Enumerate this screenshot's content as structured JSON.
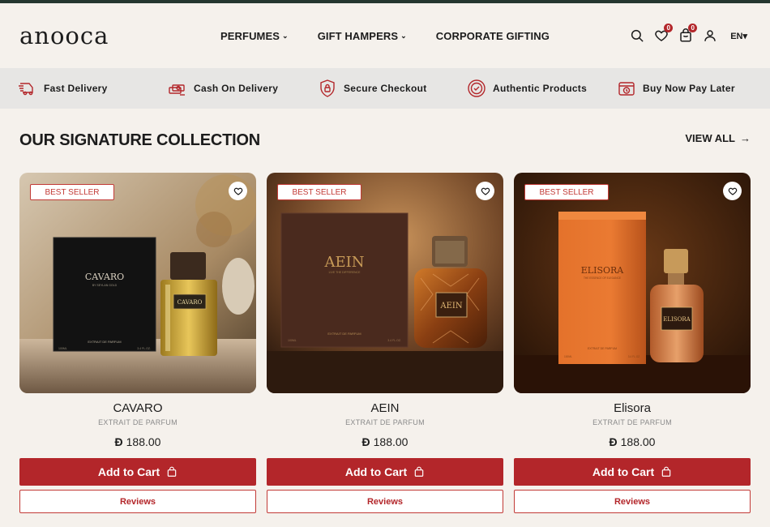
{
  "brand": {
    "logo": "anooca"
  },
  "nav": {
    "perfumes": "PERFUMES",
    "gift_hampers": "GIFT HAMPERS",
    "corporate_gifting": "CORPORATE GIFTING"
  },
  "header": {
    "wishlist_count": "0",
    "cart_count": "0",
    "language": "EN"
  },
  "features": [
    {
      "label": "Fast Delivery",
      "icon": "truck-icon"
    },
    {
      "label": "Cash On Delivery",
      "icon": "cash-icon"
    },
    {
      "label": "Secure Checkout",
      "icon": "shield-lock-icon"
    },
    {
      "label": "Authentic Products",
      "icon": "certified-badge-icon"
    },
    {
      "label": "Buy Now Pay Later",
      "icon": "clock-wallet-icon"
    }
  ],
  "section": {
    "title": "OUR SIGNATURE COLLECTION",
    "view_all": "VIEW ALL"
  },
  "products": [
    {
      "badge": "BEST SELLER",
      "name": "CAVARO",
      "type": "EXTRAIT DE PARFUM",
      "currency": "Đ",
      "price": "188.00",
      "add_to_cart": "Add to Cart",
      "reviews": "Reviews",
      "box_title": "CAVARO",
      "box_sub": "BY SEYLAN GOLD",
      "box_bottom": "EXTRAIT DE PARFUM",
      "box_vol_left": "100ML",
      "box_vol_right": "3.4 FL.OZ.",
      "bottle_label": "CAVARO"
    },
    {
      "badge": "BEST SELLER",
      "name": "AEIN",
      "type": "EXTRAIT DE PARFUM",
      "currency": "Đ",
      "price": "188.00",
      "add_to_cart": "Add to Cart",
      "reviews": "Reviews",
      "box_title": "AEIN",
      "box_sub": "LIVE THE DIFFERENCE",
      "box_bottom": "EXTRAIT DE PARFUM",
      "box_vol_left": "100ML",
      "box_vol_right": "3.4 FL.OZ.",
      "bottle_label": "AEIN"
    },
    {
      "badge": "BEST SELLER",
      "name": "Elisora",
      "type": "EXTRAIT DE PARFUM",
      "currency": "Đ",
      "price": "188.00",
      "add_to_cart": "Add to Cart",
      "reviews": "Reviews",
      "box_title": "ELISORA",
      "box_sub": "THE ESSENCE OF ELEGANCE",
      "box_bottom": "EXTRAIT DE PARFUM",
      "box_vol_left": "100ML",
      "box_vol_right": "3.4 FL.OZ.",
      "bottle_label": "ELISORA"
    }
  ],
  "colors": {
    "accent": "#b3262a",
    "background": "#f5f1ec",
    "feature_bar": "#e7e6e4",
    "topbar": "#24362f"
  }
}
